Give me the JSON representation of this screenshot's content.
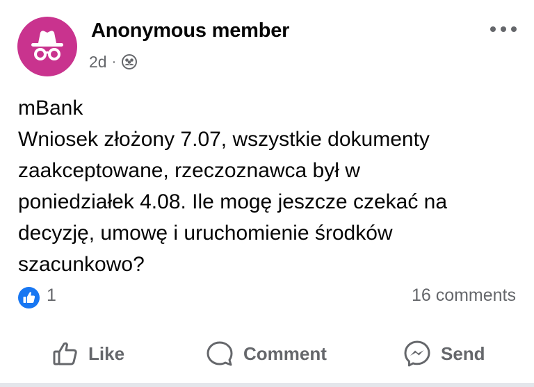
{
  "post": {
    "author": "Anonymous member",
    "time": "2d",
    "separator": "·",
    "audience_icon": "group-icon",
    "avatar_icon": "anonymous-incognito-icon",
    "avatar_color": "#c9338e",
    "body_lines": [
      "mBank",
      "Wniosek złożony 7.07, wszystkie dokumenty",
      "zaakceptowane, rzeczoznawca był w",
      "poniedziałek 4.08. Ile mogę jeszcze czekać na",
      "decyzję, umowę i uruchomienie środków",
      "szacunkowo?"
    ],
    "reactions": {
      "icon": "like-reaction-icon",
      "count": "1",
      "color": "#1877f2"
    },
    "comments_count": "16 comments"
  },
  "actions": {
    "like": "Like",
    "comment": "Comment",
    "send": "Send"
  },
  "colors": {
    "text": "#050505",
    "secondary": "#65676b",
    "accent": "#1877f2"
  }
}
